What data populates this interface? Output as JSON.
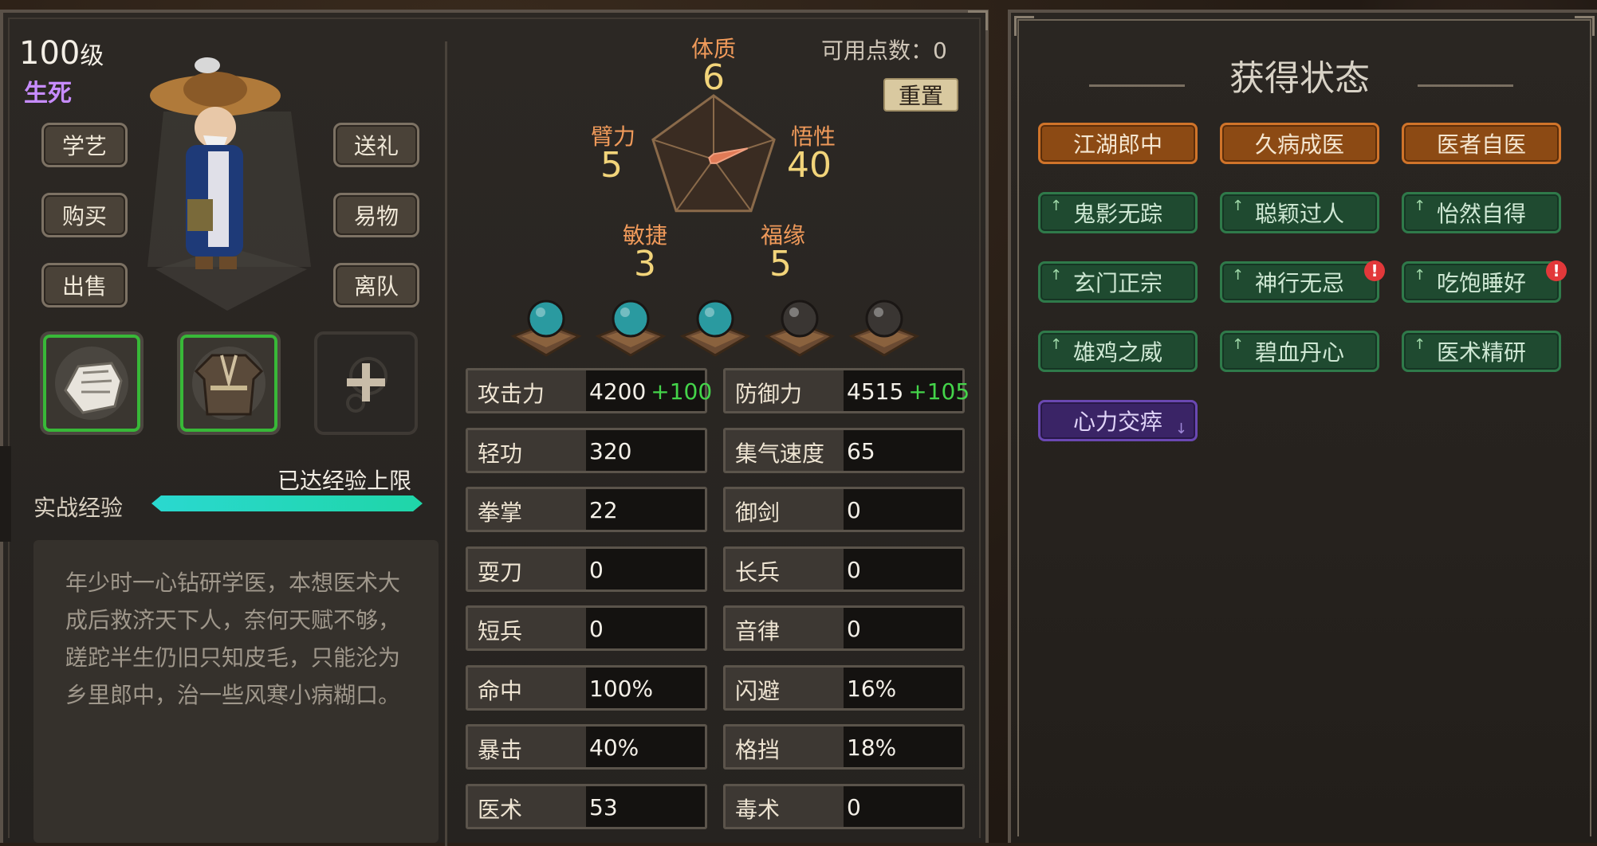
{
  "character": {
    "level_number": "100",
    "level_suffix": "级",
    "rank": "生死"
  },
  "actions": {
    "learn": "学艺",
    "buy": "购买",
    "sell": "出售",
    "gift": "送礼",
    "trade": "易物",
    "leave": "离队"
  },
  "equipment": [
    {
      "name": "gloves-icon",
      "equipped": true
    },
    {
      "name": "robe-icon",
      "equipped": true
    },
    {
      "name": "add-slot-icon",
      "equipped": false
    }
  ],
  "experience": {
    "label": "实战经验",
    "status": "已达经验上限",
    "progress": 1.0
  },
  "description": "年少时一心钻研学医，本想医术大成后救济天下人，奈何天赋不够，蹉跎半生仍旧只知皮毛，只能沦为乡里郎中，治一些风寒小病糊口。",
  "attributes": {
    "points_label": "可用点数：",
    "points_value": "0",
    "reset_label": "重置",
    "items": [
      {
        "name": "体质",
        "value": "6"
      },
      {
        "name": "悟性",
        "value": "40"
      },
      {
        "name": "福缘",
        "value": "5"
      },
      {
        "name": "敏捷",
        "value": "3"
      },
      {
        "name": "臂力",
        "value": "5"
      }
    ]
  },
  "orbs": {
    "total": 5,
    "filled": 3,
    "colors": {
      "filled": "#2a9aa0",
      "empty": "#3a3633"
    }
  },
  "stats": [
    {
      "label": "攻击力",
      "value": "4200",
      "bonus": "+100"
    },
    {
      "label": "防御力",
      "value": "4515",
      "bonus": "+105"
    },
    {
      "label": "轻功",
      "value": "320",
      "bonus": ""
    },
    {
      "label": "集气速度",
      "value": "65",
      "bonus": ""
    },
    {
      "label": "拳掌",
      "value": "22",
      "bonus": ""
    },
    {
      "label": "御剑",
      "value": "0",
      "bonus": ""
    },
    {
      "label": "耍刀",
      "value": "0",
      "bonus": ""
    },
    {
      "label": "长兵",
      "value": "0",
      "bonus": ""
    },
    {
      "label": "短兵",
      "value": "0",
      "bonus": ""
    },
    {
      "label": "音律",
      "value": "0",
      "bonus": ""
    },
    {
      "label": "命中",
      "value": "100%",
      "bonus": ""
    },
    {
      "label": "闪避",
      "value": "16%",
      "bonus": ""
    },
    {
      "label": "暴击",
      "value": "40%",
      "bonus": ""
    },
    {
      "label": "格挡",
      "value": "18%",
      "bonus": ""
    },
    {
      "label": "医术",
      "value": "53",
      "bonus": ""
    },
    {
      "label": "毒术",
      "value": "0",
      "bonus": ""
    }
  ],
  "status_panel": {
    "title": "获得状态",
    "tags": [
      {
        "label": "江湖郎中",
        "type": "orange",
        "arrow": "",
        "alert": false
      },
      {
        "label": "久病成医",
        "type": "orange",
        "arrow": "",
        "alert": false
      },
      {
        "label": "医者自医",
        "type": "orange",
        "arrow": "",
        "alert": false
      },
      {
        "label": "鬼影无踪",
        "type": "green",
        "arrow": "up",
        "alert": false
      },
      {
        "label": "聪颖过人",
        "type": "green",
        "arrow": "up",
        "alert": false
      },
      {
        "label": "怡然自得",
        "type": "green",
        "arrow": "up",
        "alert": false
      },
      {
        "label": "玄门正宗",
        "type": "green",
        "arrow": "up",
        "alert": false
      },
      {
        "label": "神行无忌",
        "type": "green",
        "arrow": "up",
        "alert": true
      },
      {
        "label": "吃饱睡好",
        "type": "green",
        "arrow": "up",
        "alert": true
      },
      {
        "label": "雄鸡之威",
        "type": "green",
        "arrow": "up",
        "alert": false
      },
      {
        "label": "碧血丹心",
        "type": "green",
        "arrow": "up",
        "alert": false
      },
      {
        "label": "医术精研",
        "type": "green",
        "arrow": "up",
        "alert": false
      },
      {
        "label": "心力交瘁",
        "type": "purple",
        "arrow": "down",
        "alert": false
      }
    ]
  },
  "colors": {
    "accent_orange": "#f09a5a",
    "accent_gold": "#f2d47a",
    "rank_purple": "#c78cff",
    "bonus_green": "#44d44a",
    "exp_bar": "#2ad8d0"
  }
}
